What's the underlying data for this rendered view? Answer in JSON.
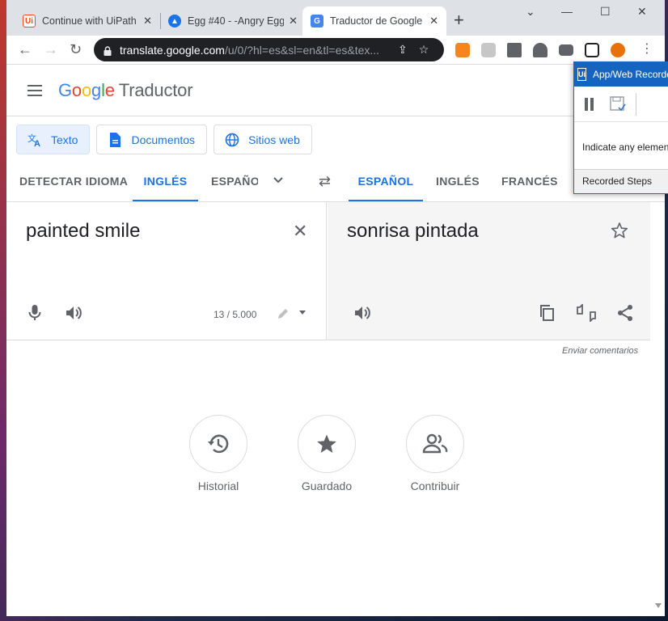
{
  "browser": {
    "tabs": [
      {
        "title": "Continue with UiPath",
        "active": false
      },
      {
        "title": "Egg #40 - -Angry Egg",
        "active": false
      },
      {
        "title": "Traductor de Google",
        "active": true
      }
    ],
    "url_host": "translate.google.com",
    "url_path": "/u/0/?hl=es&sl=en&tl=es&tex..."
  },
  "header": {
    "logo_letters": [
      "G",
      "o",
      "o",
      "g",
      "l",
      "e"
    ],
    "product": "Traductor"
  },
  "modes": [
    {
      "label": "Texto",
      "icon": "translate-icon",
      "selected": true
    },
    {
      "label": "Documentos",
      "icon": "document-icon",
      "selected": false
    },
    {
      "label": "Sitios web",
      "icon": "globe-icon",
      "selected": false
    }
  ],
  "source_langs": [
    {
      "label": "DETECTAR IDIOMA",
      "selected": false
    },
    {
      "label": "INGLÉS",
      "selected": true
    },
    {
      "label": "ESPAÑOL",
      "selected": false
    }
  ],
  "target_langs": [
    {
      "label": "ESPAÑOL",
      "selected": true
    },
    {
      "label": "INGLÉS",
      "selected": false
    },
    {
      "label": "FRANCÉS",
      "selected": false
    }
  ],
  "source": {
    "text": "painted smile",
    "counter": "13 / 5.000"
  },
  "target": {
    "text": "sonrisa pintada"
  },
  "feedback": "Enviar comentarios",
  "actions": [
    {
      "label": "Historial",
      "icon": "history-icon"
    },
    {
      "label": "Guardado",
      "icon": "star-icon"
    },
    {
      "label": "Contribuir",
      "icon": "people-icon"
    }
  ],
  "recorder": {
    "title": "App/Web Recorder",
    "message": "Indicate any element",
    "steps": "Recorded Steps"
  },
  "colors": {
    "accent": "#1a73e8",
    "recorder": "#1565c0"
  }
}
